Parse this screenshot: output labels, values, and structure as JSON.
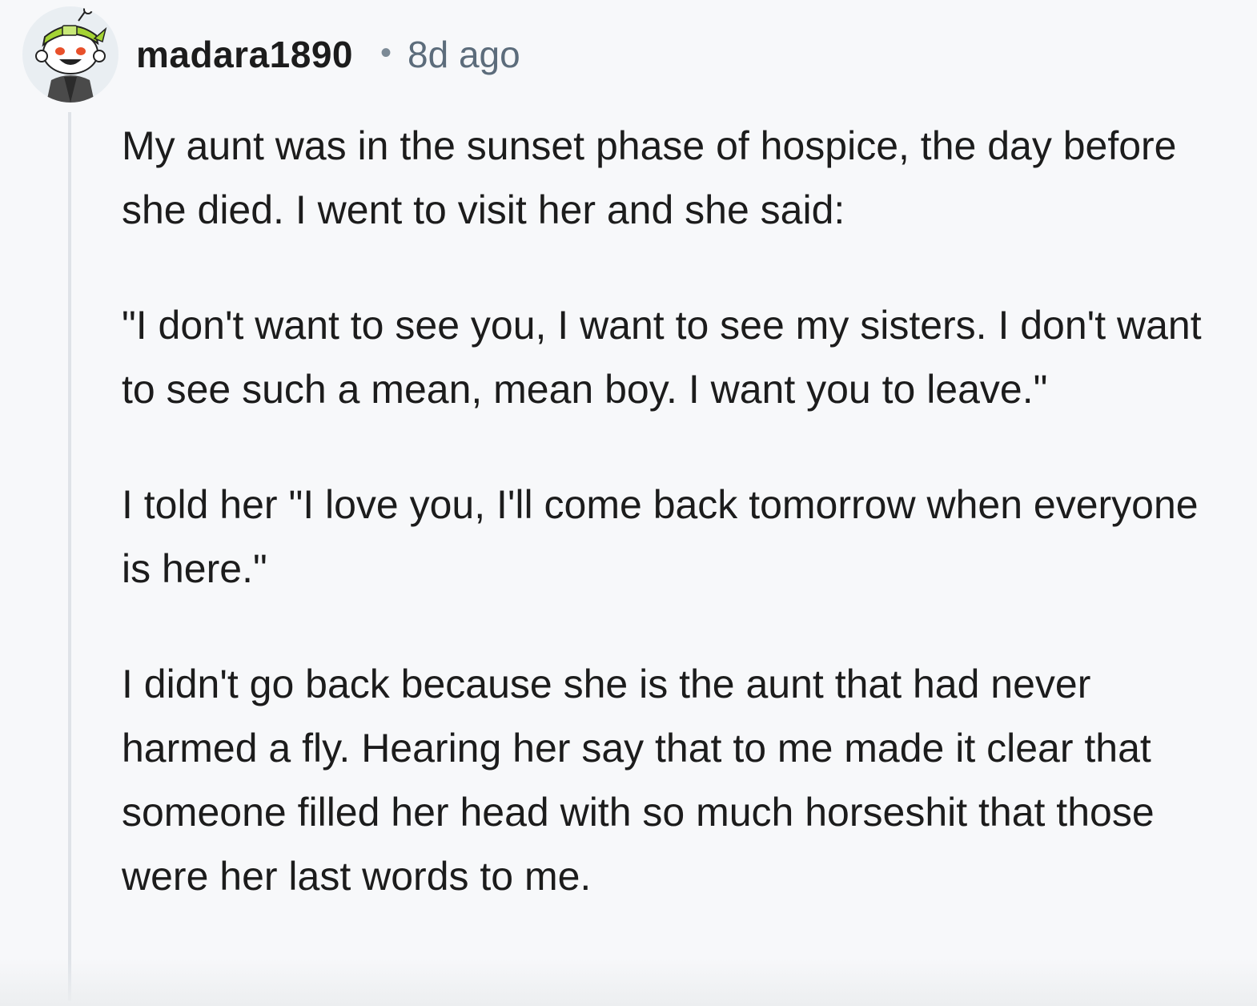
{
  "comment": {
    "author": "madara1890",
    "separator": "•",
    "age": "8d ago",
    "avatar_icon": "snoo-avatar-green-headband-icon",
    "paragraphs": [
      "My aunt was in the sunset phase of hospice, the day before she died. I went to visit her and she said:",
      "\"I don't want to see you, I want to see my sisters. I don't want to see such a mean, mean boy. I want you to leave.\"",
      "I told her \"I love you, I'll come back tomorrow when everyone is here.\"",
      "I didn't go back because she is the aunt that had never harmed a fly. Hearing her say that to me made it clear that someone filled her head with so much horseshit that those were her last words to me."
    ]
  },
  "colors": {
    "background": "#f7f8fa",
    "text": "#1c1c1c",
    "meta": "#5c6c7b",
    "thread_line": "#dfe3e8",
    "avatar_accent": "#a4d334"
  }
}
